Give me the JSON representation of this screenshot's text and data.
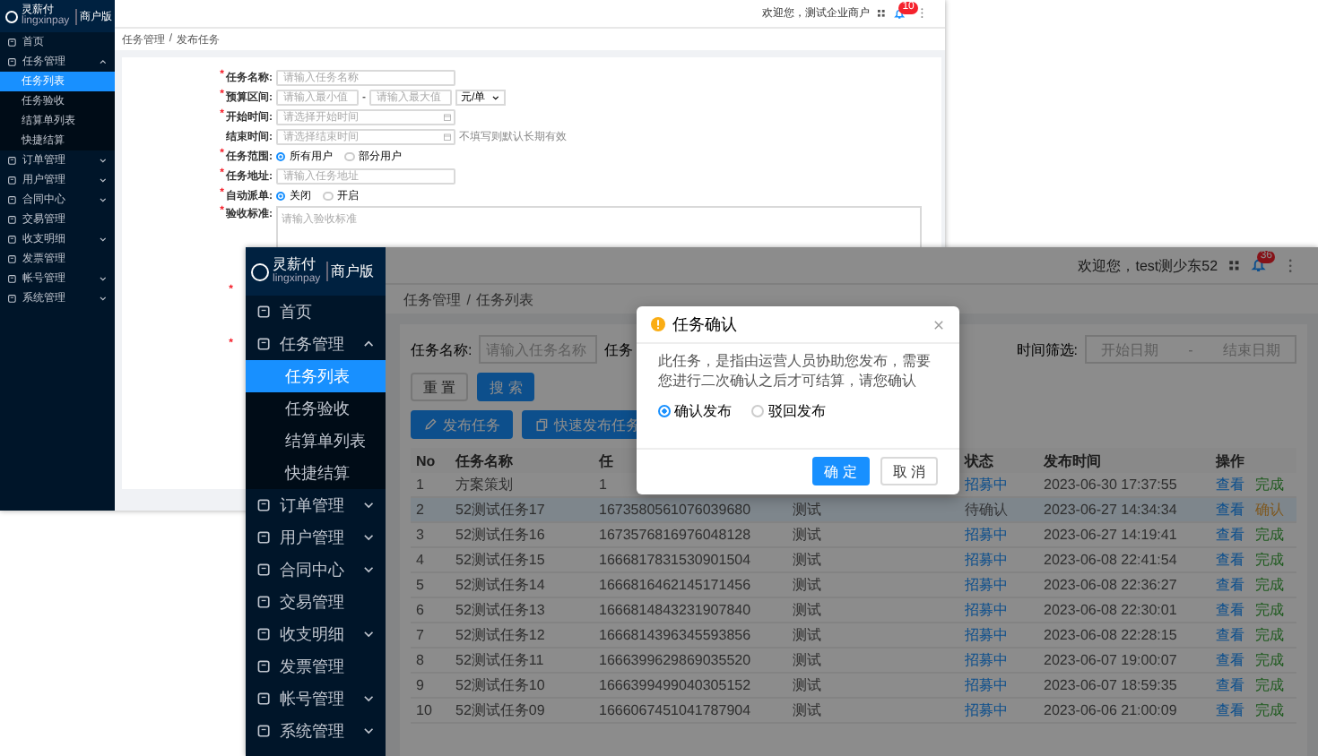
{
  "back_window": {
    "logo": {
      "name": "灵薪付",
      "sub": "lingxinpay",
      "edition": "商户版"
    },
    "header": {
      "welcome": "欢迎您，测试企业商户",
      "badge": "10"
    },
    "sidebar": {
      "items": [
        {
          "kind": "link",
          "label": "首页",
          "selected": false
        },
        {
          "kind": "group",
          "label": "任务管理",
          "selected": false,
          "expanded": true,
          "children": [
            {
              "label": "任务列表",
              "selected": true
            },
            {
              "label": "任务验收",
              "selected": false
            },
            {
              "label": "结算单列表",
              "selected": false
            },
            {
              "label": "快捷结算",
              "selected": false
            }
          ]
        },
        {
          "kind": "group",
          "label": "订单管理",
          "selected": false,
          "expanded": false
        },
        {
          "kind": "group",
          "label": "用户管理",
          "selected": false,
          "expanded": false
        },
        {
          "kind": "group",
          "label": "合同中心",
          "selected": false,
          "expanded": false
        },
        {
          "kind": "link",
          "label": "交易管理",
          "selected": false
        },
        {
          "kind": "group",
          "label": "收支明细",
          "selected": false,
          "expanded": false
        },
        {
          "kind": "link",
          "label": "发票管理",
          "selected": false
        },
        {
          "kind": "group",
          "label": "帐号管理",
          "selected": false,
          "expanded": false
        },
        {
          "kind": "group",
          "label": "系统管理",
          "selected": false,
          "expanded": false
        }
      ]
    },
    "breadcrumb": {
      "items": [
        "任务管理",
        "发布任务"
      ],
      "separator": "/"
    },
    "form": {
      "fields": [
        {
          "kind": "text",
          "mark": "*",
          "label": "任务名称:",
          "placeholder": "请输入任务名称"
        },
        {
          "kind": "range",
          "mark": "*",
          "label": "预算区间:",
          "placeholder_min": "请输入最小值",
          "separator": "-",
          "placeholder_max": "请输入最大值",
          "unit": "元/单"
        },
        {
          "kind": "date",
          "mark": "*",
          "label": "开始时间:",
          "placeholder": "请选择开始时间"
        },
        {
          "kind": "date",
          "label": "结束时间:",
          "placeholder": "请选择结束时间",
          "hint": "不填写则默认长期有效"
        },
        {
          "kind": "radio",
          "mark": "*",
          "label": "任务范围:",
          "options": [
            {
              "label": "所有用户",
              "selected": true
            },
            {
              "label": "部分用户",
              "selected": false
            }
          ]
        },
        {
          "kind": "text",
          "mark": "*",
          "label": "任务地址:",
          "placeholder": "请输入任务地址"
        },
        {
          "kind": "radio",
          "mark": "*",
          "label": "自动派单:",
          "options": [
            {
              "label": "关闭",
              "selected": true
            },
            {
              "label": "开启",
              "selected": false
            }
          ]
        },
        {
          "kind": "textarea",
          "mark": "*",
          "label": "验收标准:",
          "placeholder": "请输入验收标准"
        },
        {
          "kind": "cut",
          "mark": "*"
        },
        {
          "kind": "cut",
          "mark": "*"
        }
      ]
    }
  },
  "front_window": {
    "logo": {
      "name": "灵薪付",
      "sub": "lingxinpay",
      "edition": "商户版"
    },
    "header": {
      "welcome": "欢迎您，test测少东52",
      "badge": "36"
    },
    "sidebar": {
      "items": [
        {
          "kind": "link",
          "label": "首页",
          "selected": false
        },
        {
          "kind": "group",
          "label": "任务管理",
          "selected": false,
          "expanded": true,
          "children": [
            {
              "label": "任务列表",
              "selected": true
            },
            {
              "label": "任务验收",
              "selected": false
            },
            {
              "label": "结算单列表",
              "selected": false
            },
            {
              "label": "快捷结算",
              "selected": false
            }
          ]
        },
        {
          "kind": "group",
          "label": "订单管理",
          "selected": false,
          "expanded": false
        },
        {
          "kind": "group",
          "label": "用户管理",
          "selected": false,
          "expanded": false
        },
        {
          "kind": "group",
          "label": "合同中心",
          "selected": false,
          "expanded": false
        },
        {
          "kind": "link",
          "label": "交易管理",
          "selected": false
        },
        {
          "kind": "group",
          "label": "收支明细",
          "selected": false,
          "expanded": false
        },
        {
          "kind": "link",
          "label": "发票管理",
          "selected": false
        },
        {
          "kind": "group",
          "label": "帐号管理",
          "selected": false,
          "expanded": false
        },
        {
          "kind": "group",
          "label": "系统管理",
          "selected": false,
          "expanded": false
        }
      ]
    },
    "breadcrumb": {
      "items": [
        "任务管理",
        "任务列表"
      ],
      "separator": "/"
    },
    "filters": {
      "name_label": "任务名称:",
      "name_placeholder": "请输入任务名称",
      "type_label": "任务",
      "time_label": "时间筛选:",
      "start_placeholder": "开始日期",
      "range_separator": "-",
      "end_placeholder": "结束日期"
    },
    "buttons": {
      "reset": "重 置",
      "search": "搜 索",
      "publish": "发布任务",
      "quick_publish": "快速发布任务"
    },
    "table": {
      "columns": [
        {
          "label": "No"
        },
        {
          "label": "任务名称"
        },
        {
          "label": "任"
        },
        {},
        {
          "label": "状态"
        },
        {
          "label": "发布时间"
        },
        {
          "label": "操作"
        }
      ],
      "rows": [
        {
          "selected": false,
          "no": "1",
          "name": "方案策划",
          "id": "1",
          "status": {
            "text": "招募中",
            "kind": "recruiting"
          },
          "time": "2023-06-30 17:37:55",
          "view": "查看",
          "action": {
            "text": "完成",
            "kind": "complete"
          }
        },
        {
          "selected": true,
          "no": "2",
          "name": "52测试任务17",
          "id": "1673580561076039680",
          "type": "测试",
          "status": {
            "text": "待确认",
            "kind": "pending"
          },
          "time": "2023-06-27 14:34:34",
          "view": "查看",
          "action": {
            "text": "确认",
            "kind": "confirm"
          }
        },
        {
          "selected": false,
          "no": "3",
          "name": "52测试任务16",
          "id": "1673576816976048128",
          "type": "测试",
          "status": {
            "text": "招募中",
            "kind": "recruiting"
          },
          "time": "2023-06-27 14:19:41",
          "view": "查看",
          "action": {
            "text": "完成",
            "kind": "complete"
          }
        },
        {
          "selected": false,
          "no": "4",
          "name": "52测试任务15",
          "id": "1666817831530901504",
          "type": "测试",
          "status": {
            "text": "招募中",
            "kind": "recruiting"
          },
          "time": "2023-06-08 22:41:54",
          "view": "查看",
          "action": {
            "text": "完成",
            "kind": "complete"
          }
        },
        {
          "selected": false,
          "no": "5",
          "name": "52测试任务14",
          "id": "1666816462145171456",
          "type": "测试",
          "status": {
            "text": "招募中",
            "kind": "recruiting"
          },
          "time": "2023-06-08 22:36:27",
          "view": "查看",
          "action": {
            "text": "完成",
            "kind": "complete"
          }
        },
        {
          "selected": false,
          "no": "6",
          "name": "52测试任务13",
          "id": "1666814843231907840",
          "type": "测试",
          "status": {
            "text": "招募中",
            "kind": "recruiting"
          },
          "time": "2023-06-08 22:30:01",
          "view": "查看",
          "action": {
            "text": "完成",
            "kind": "complete"
          }
        },
        {
          "selected": false,
          "no": "7",
          "name": "52测试任务12",
          "id": "1666814396345593856",
          "type": "测试",
          "status": {
            "text": "招募中",
            "kind": "recruiting"
          },
          "time": "2023-06-08 22:28:15",
          "view": "查看",
          "action": {
            "text": "完成",
            "kind": "complete"
          }
        },
        {
          "selected": false,
          "no": "8",
          "name": "52测试任务11",
          "id": "1666399629869035520",
          "type": "测试",
          "status": {
            "text": "招募中",
            "kind": "recruiting"
          },
          "time": "2023-06-07 19:00:07",
          "view": "查看",
          "action": {
            "text": "完成",
            "kind": "complete"
          }
        },
        {
          "selected": false,
          "no": "9",
          "name": "52测试任务10",
          "id": "1666399499040305152",
          "type": "测试",
          "status": {
            "text": "招募中",
            "kind": "recruiting"
          },
          "time": "2023-06-07 18:59:35",
          "view": "查看",
          "action": {
            "text": "完成",
            "kind": "complete"
          }
        },
        {
          "selected": false,
          "no": "10",
          "name": "52测试任务09",
          "id": "1666067451041787904",
          "type": "测试",
          "status": {
            "text": "招募中",
            "kind": "recruiting"
          },
          "time": "2023-06-06 21:00:09",
          "view": "查看",
          "action": {
            "text": "完成",
            "kind": "complete"
          }
        }
      ]
    },
    "dialog": {
      "title": "任务确认",
      "message": "此任务，是指由运营人员协助您发布，需要您进行二次确认之后才可结算，请您确认",
      "options": [
        {
          "label": "确认发布",
          "selected": true
        },
        {
          "label": "驳回发布",
          "selected": false
        }
      ],
      "confirm": "确 定",
      "cancel": "取 消"
    }
  }
}
